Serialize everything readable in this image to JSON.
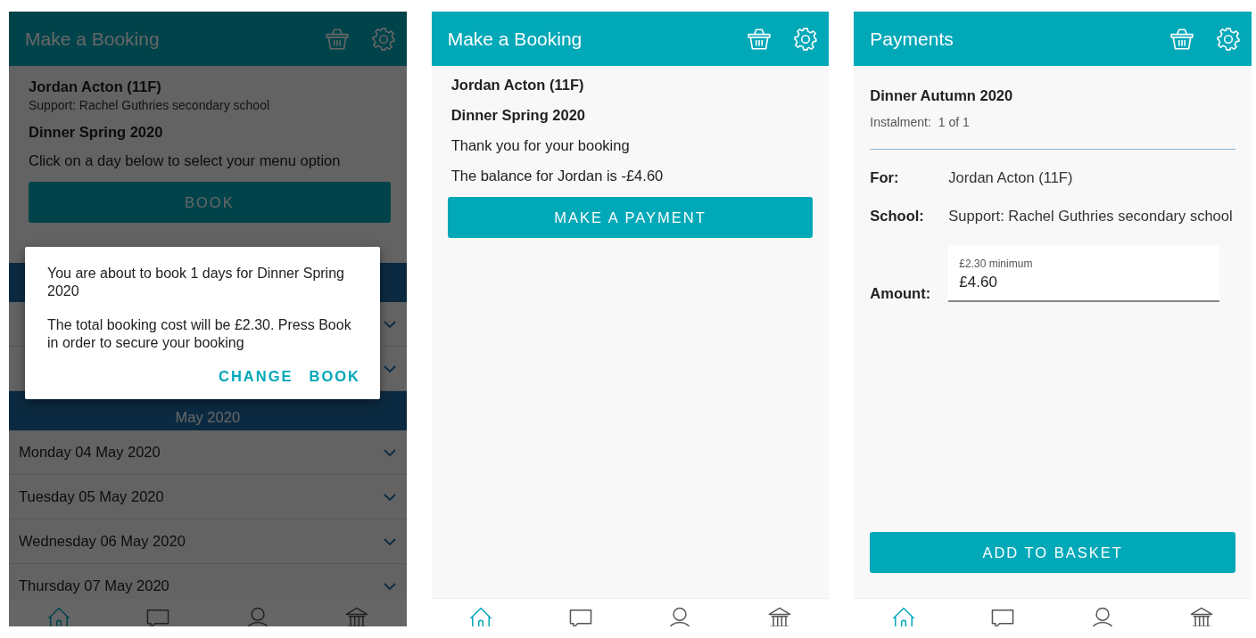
{
  "screens": [
    {
      "kind": "booking",
      "title": "Make a Booking",
      "student": "Jordan Acton (11F)",
      "school": "Support: Rachel Guthries secondary school",
      "course": "Dinner Spring 2020",
      "instruction": "Click on a day below to select your menu option",
      "button": "BOOK",
      "sections": [
        {
          "days": [
            {
              "expanded": false
            },
            {
              "expanded": false
            }
          ]
        },
        {
          "month": "May 2020",
          "days": [
            {
              "label": "Monday 04 May 2020",
              "expanded": false
            },
            {
              "label": "Tuesday 05 May 2020",
              "expanded": false
            },
            {
              "label": "Wednesday 06 May 2020",
              "expanded": false
            },
            {
              "label": "Thursday 07 May 2020",
              "expanded": false
            }
          ]
        }
      ],
      "dialog": {
        "message": "You are about to book 1 days for Dinner Spring 2020",
        "detail": "The total booking cost will be £2.30. Press Book in order to secure your booking",
        "actions": [
          "CHANGE",
          "BOOK"
        ]
      },
      "nav": [
        {
          "kind": "home",
          "selected": true
        },
        {
          "kind": "chat",
          "selected": false
        },
        {
          "kind": "person",
          "selected": false
        },
        {
          "kind": "bank",
          "selected": false
        }
      ]
    },
    {
      "kind": "confirmation",
      "title": "Make a Booking",
      "student": "Jordan Acton (11F)",
      "course": "Dinner Spring 2020",
      "messages": [
        "Thank you for your booking",
        "The balance for Jordan is -£4.60"
      ],
      "button": "MAKE A PAYMENT",
      "nav": [
        {
          "kind": "home",
          "selected": true
        },
        {
          "kind": "chat",
          "selected": false
        },
        {
          "kind": "person",
          "selected": false
        },
        {
          "kind": "bank",
          "selected": false
        }
      ]
    },
    {
      "kind": "payment",
      "title": "Payments",
      "course": "Dinner Autumn 2020",
      "instalment_label": "Instalment:",
      "instalment": "1 of 1",
      "fields": [
        {
          "label": "For:",
          "value": "Jordan Acton (11F)"
        },
        {
          "label": "School:",
          "value": "Support: Rachel Guthries secondary school"
        }
      ],
      "amount": {
        "label": "Amount:",
        "floating_label": "£2.30 minimum",
        "value": "£4.60"
      },
      "button": "ADD TO BASKET",
      "nav": [
        {
          "kind": "home",
          "selected": true
        },
        {
          "kind": "chat",
          "selected": false
        },
        {
          "kind": "person",
          "selected": false
        },
        {
          "kind": "bank",
          "selected": false
        }
      ]
    }
  ]
}
